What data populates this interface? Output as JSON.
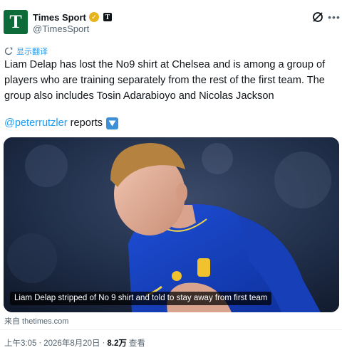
{
  "author": {
    "avatar_letter": "T",
    "name": "Times Sport",
    "handle": "@TimesSport",
    "affiliate_badge": "T"
  },
  "translate_label": "显示翻译",
  "post": {
    "text": "Liam Delap has lost the No9 shirt at Chelsea and is among a group of players who are training separately from the rest of the first team. The group also includes Tosin Adarabioyo and Nicolas Jackson",
    "mention": "@peterrutzler",
    "mention_suffix": " reports",
    "emoji": "down-arrow-emoji"
  },
  "media": {
    "caption": "Liam Delap stripped of No 9 shirt and told to stay away from first team",
    "alt": "Footballer in blue Chelsea kit"
  },
  "card_source": "来自 thetimes.com",
  "meta": {
    "time": "上午3:05",
    "separator": "·",
    "date": "2026年8月20日",
    "views_count": "8.2万",
    "views_label": "查看"
  },
  "colors": {
    "accent": "#1d9bf0",
    "avatar_bg": "#0d6b3a",
    "verified": "#e7b41e",
    "text_secondary": "#536471"
  }
}
